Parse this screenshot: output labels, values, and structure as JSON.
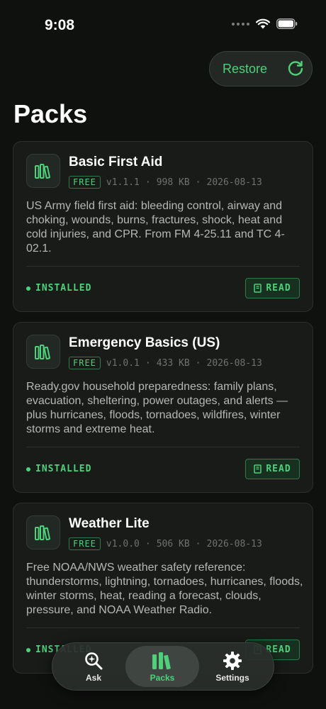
{
  "status_bar": {
    "time": "9:08"
  },
  "header": {
    "restore_label": "Restore",
    "title": "Packs"
  },
  "packs": [
    {
      "title": "Basic First Aid",
      "badge": "FREE",
      "version": "v1.1.1",
      "size": "998 KB",
      "date": "2026-08-13",
      "description": "US Army field first aid: bleeding control, airway and choking, wounds, burns, fractures, shock, heat and cold injuries, and CPR. From FM 4-25.11 and TC 4-02.1.",
      "status": "INSTALLED",
      "action": "READ"
    },
    {
      "title": "Emergency Basics (US)",
      "badge": "FREE",
      "version": "v1.0.1",
      "size": "433 KB",
      "date": "2026-08-13",
      "description": "Ready.gov household preparedness: family plans, evacuation, sheltering, power outages, and alerts — plus hurricanes, floods, tornadoes, wildfires, winter storms and extreme heat.",
      "status": "INSTALLED",
      "action": "READ"
    },
    {
      "title": "Weather Lite",
      "badge": "FREE",
      "version": "v1.0.0",
      "size": "506 KB",
      "date": "2026-08-13",
      "description": "Free NOAA/NWS weather safety reference: thunderstorms, lightning, tornadoes, hurricanes, floods, winter storms, heat, reading a forecast, clouds, pressure, and NOAA Weather Radio.",
      "status": "INSTALLED",
      "action": "READ"
    }
  ],
  "meta_separator": "·",
  "tabs": [
    {
      "label": "Ask",
      "icon": "magnifier-sparkle-icon"
    },
    {
      "label": "Packs",
      "icon": "books-icon",
      "active": true
    },
    {
      "label": "Settings",
      "icon": "gear-icon"
    }
  ],
  "colors": {
    "accent": "#4fd07a",
    "background": "#0f110f",
    "card": "#181b18"
  }
}
